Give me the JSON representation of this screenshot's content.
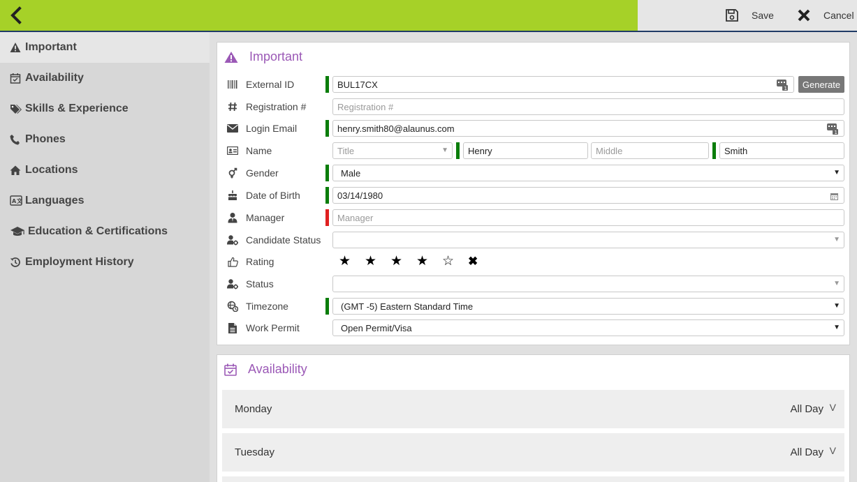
{
  "topbar": {
    "save_label": "Save",
    "cancel_label": "Cancel"
  },
  "sidebar": {
    "items": [
      {
        "label": "Important",
        "icon": "warning-icon"
      },
      {
        "label": "Availability",
        "icon": "calendar-check-icon"
      },
      {
        "label": "Skills & Experience",
        "icon": "tags-icon"
      },
      {
        "label": "Phones",
        "icon": "phone-icon"
      },
      {
        "label": "Locations",
        "icon": "home-icon"
      },
      {
        "label": "Languages",
        "icon": "language-icon"
      },
      {
        "label": "Education & Certifications",
        "icon": "graduation-cap-icon"
      },
      {
        "label": "Employment History",
        "icon": "history-icon"
      }
    ]
  },
  "important": {
    "title": "Important",
    "external_id": {
      "label": "External ID",
      "value": "BUL17CX",
      "generate_label": "Generate"
    },
    "registration": {
      "label": "Registration #",
      "placeholder": "Registration #"
    },
    "login_email": {
      "label": "Login Email",
      "value": "henry.smith80@alaunus.com"
    },
    "name": {
      "label": "Name",
      "title_placeholder": "Title",
      "first": "Henry",
      "middle_placeholder": "Middle",
      "last": "Smith"
    },
    "gender": {
      "label": "Gender",
      "value": "Male"
    },
    "dob": {
      "label": "Date of Birth",
      "value": "03/14/1980"
    },
    "manager": {
      "label": "Manager",
      "placeholder": "Manager"
    },
    "candidate_status": {
      "label": "Candidate Status",
      "value": ""
    },
    "rating": {
      "label": "Rating",
      "value": 4,
      "max": 5
    },
    "status": {
      "label": "Status",
      "value": ""
    },
    "timezone": {
      "label": "Timezone",
      "value": "(GMT -5) Eastern Standard Time"
    },
    "work_permit": {
      "label": "Work Permit",
      "value": "Open Permit/Visa"
    }
  },
  "availability": {
    "title": "Availability",
    "days": [
      {
        "day": "Monday",
        "value": "All Day"
      },
      {
        "day": "Tuesday",
        "value": "All Day"
      }
    ]
  },
  "colors": {
    "accent_green": "#a6d128",
    "required_green": "#0a7d0a",
    "required_red": "#e02020",
    "section_purple": "#9b59b6"
  }
}
